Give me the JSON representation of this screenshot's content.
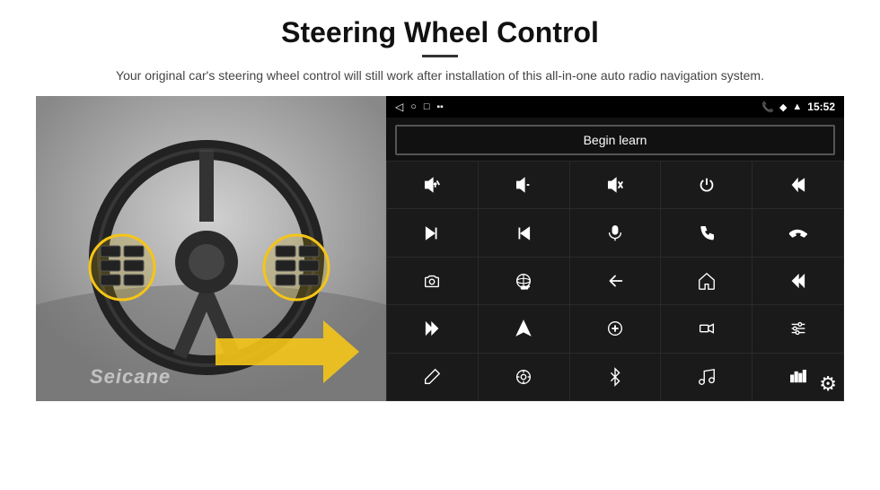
{
  "header": {
    "title": "Steering Wheel Control",
    "divider": true,
    "subtitle": "Your original car's steering wheel control will still work after installation of this all-in-one auto radio navigation system."
  },
  "status_bar": {
    "left_icons": [
      "back-arrow",
      "home-circle",
      "square-recent"
    ],
    "right_icons": [
      "phone-icon",
      "location-icon",
      "wifi-icon",
      "battery-icon"
    ],
    "time": "15:52"
  },
  "begin_learn": {
    "label": "Begin learn"
  },
  "icon_grid": [
    {
      "id": "vol-up",
      "symbol": "vol+"
    },
    {
      "id": "vol-down",
      "symbol": "vol-"
    },
    {
      "id": "mute",
      "symbol": "mute"
    },
    {
      "id": "power",
      "symbol": "pwr"
    },
    {
      "id": "prev-track",
      "symbol": "prev"
    },
    {
      "id": "skip-forward",
      "symbol": "skip+"
    },
    {
      "id": "skip-back",
      "symbol": "skip-"
    },
    {
      "id": "mic",
      "symbol": "mic"
    },
    {
      "id": "phone",
      "symbol": "ph"
    },
    {
      "id": "hang-up",
      "symbol": "hup"
    },
    {
      "id": "cam",
      "symbol": "cam"
    },
    {
      "id": "360-view",
      "symbol": "360"
    },
    {
      "id": "back-nav",
      "symbol": "back"
    },
    {
      "id": "home-nav",
      "symbol": "home"
    },
    {
      "id": "prev2",
      "symbol": "prev2"
    },
    {
      "id": "next2",
      "symbol": "next2"
    },
    {
      "id": "navigate",
      "symbol": "nav"
    },
    {
      "id": "reverse",
      "symbol": "rev"
    },
    {
      "id": "record",
      "symbol": "rec"
    },
    {
      "id": "equalizer",
      "symbol": "eq"
    },
    {
      "id": "pen",
      "symbol": "pen"
    },
    {
      "id": "settings-btn",
      "symbol": "set"
    },
    {
      "id": "bluetooth",
      "symbol": "bt"
    },
    {
      "id": "music",
      "symbol": "mus"
    },
    {
      "id": "sound-bars",
      "symbol": "snd"
    }
  ],
  "watermark": {
    "text": "Seicane"
  },
  "gear": {
    "label": "⚙"
  }
}
